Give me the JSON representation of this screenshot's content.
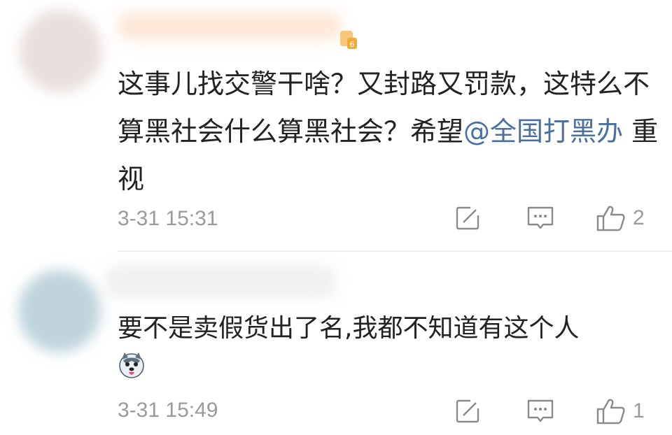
{
  "comments": [
    {
      "content_before": "这事儿找交警干啥？又封路又罚款，这特么不算黑社会什么算黑社会？希望",
      "mention": "@全国打黑办",
      "content_after": " 重视",
      "time": "3-31 15:31",
      "like_count": "2",
      "level_badge": "6"
    },
    {
      "content": "要不是卖假货出了名,我都不知道有这个人",
      "emoji": "husky-face",
      "time": "3-31 15:49",
      "like_count": "1"
    }
  ],
  "colors": {
    "mention": "#4a6fa0",
    "meta": "#9a9a9a",
    "icon": "#8a8a8a"
  },
  "icons": [
    "share-icon",
    "reply-icon",
    "like-icon"
  ]
}
